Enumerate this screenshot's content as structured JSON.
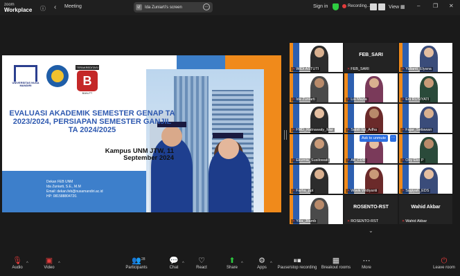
{
  "topbar": {
    "brand_line1": "zoom",
    "brand_line2": "Workplace",
    "info_icon": "info-icon",
    "meeting_label": "Meeting",
    "screen_share": {
      "initials": "IZ",
      "label": "Ida Zuniarti's screen",
      "more": "…"
    },
    "sign_in": "Sign in",
    "recording_label": "Recording...",
    "view_label": "View",
    "window_controls": [
      "–",
      "❐",
      "✕"
    ]
  },
  "slide": {
    "logo1_text": "UNIVERSITAS NUSA MANDIRI",
    "logo3_header": "TERAKREDITASI",
    "logo3_letter": "B",
    "logo3_footer": "BAN-PT",
    "title": "EVALUASI AKADEMIK SEMESTER GENAP TA 2023/2024, PERSIAPAN SEMESTER GANJIL TA 2024/2025",
    "campus": "Kampus UNM JTW, 11 September 2024",
    "dekan_lines": [
      "Dekan FEB UNM",
      "Ida Zuniarti, S.E., M.M",
      "Email: dekan.feb@nusamandiri.ac.id",
      "HP: 081588804720."
    ]
  },
  "gallery": {
    "tiles": [
      {
        "name": "WIDI ASTUTI",
        "dark": false
      },
      {
        "name": "FEB_SARI",
        "bigname": "FEB_SARI",
        "dark": true
      },
      {
        "name": "Yulianti_Elyana",
        "dark": false
      },
      {
        "name": "Ida Zuniarti",
        "dark": false
      },
      {
        "name": "Lia Mazia",
        "dark": false
      },
      {
        "name": "Eni RUSIYATI",
        "dark": false
      },
      {
        "name": "FMD_Ratnawaty_Mar",
        "dark": false
      },
      {
        "name": "Sabili Ilgi_Adha",
        "dark": false
      },
      {
        "name": "Fajar_Setiawan",
        "dark": false
      },
      {
        "name": "Ekurnia_Susilowati",
        "dark": false
      },
      {
        "name": "Ati_CDR",
        "dark": false
      },
      {
        "name": "Oby Eko P",
        "dark": false
      },
      {
        "name": "Farha_ppt",
        "dark": false
      },
      {
        "name": "Wiwik Widiyanti",
        "dark": false
      },
      {
        "name": "Sugiyah_EDS",
        "dark": false
      },
      {
        "name": "Yilia_Jilamb",
        "dark": false
      },
      {
        "name": "ROSENTO-RST",
        "bigname": "ROSENTO-RST",
        "dark": true
      },
      {
        "name": "Wahid Akbar",
        "bigname": "Wahid Akbar",
        "dark": true
      }
    ],
    "ask_to_unmute": "Ask to unmute",
    "ask_more": "…"
  },
  "toolbar": {
    "audio": "Audio",
    "video": "Video",
    "participants": "Participants",
    "participants_count": "28",
    "chat": "Chat",
    "react": "React",
    "share": "Share",
    "apps": "Apps",
    "pause_stop_recording": "Pause/stop recording",
    "breakout_rooms": "Breakout rooms",
    "more": "More",
    "leave_room": "Leave room"
  }
}
